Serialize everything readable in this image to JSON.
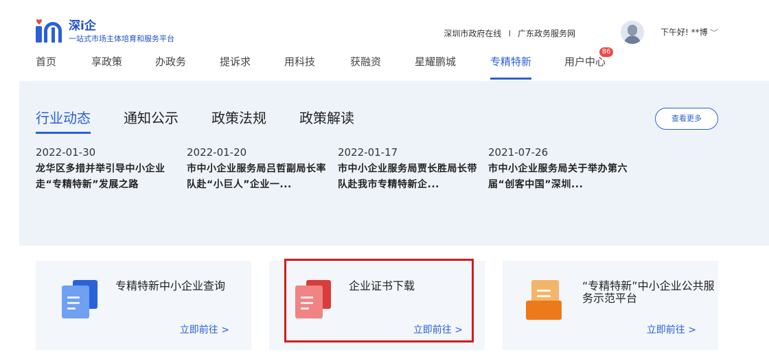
{
  "header": {
    "logo_title": "深i企",
    "logo_subtitle": "一站式市场主体培育和服务平台",
    "links": [
      "深圳市政府在线",
      "广东政务服务网"
    ],
    "link_separator": "I",
    "greeting": "下午好! **博",
    "greeting_chevron": "﹀"
  },
  "nav": {
    "items": [
      "首页",
      "享政策",
      "办政务",
      "提诉求",
      "用科技",
      "获融资",
      "星耀鹏城",
      "专精特新",
      "用户中心"
    ],
    "active": "专精特新",
    "user_badge": "86"
  },
  "news": {
    "tabs": [
      "行业动态",
      "通知公示",
      "政策法规",
      "政策解读"
    ],
    "active_tab": "行业动态",
    "more_label": "查看更多",
    "articles": [
      {
        "date": "2022-01-30",
        "title": "龙华区多措并举引导中小企业走“专精特新”发展之路"
      },
      {
        "date": "2022-01-20",
        "title": "市中小企业服务局吕哲副局长率队赴“小巨人”企业一..."
      },
      {
        "date": "2022-01-17",
        "title": "市中小企业服务局贾长胜局长带队赴我市专精特新企..."
      },
      {
        "date": "2021-07-26",
        "title": "市中小企业服务局关于举办第六届“创客中国”深圳..."
      }
    ]
  },
  "cards": [
    {
      "title": "专精特新中小企业查询",
      "link": "立即前往 >",
      "icon": "blue-document-icon"
    },
    {
      "title": "企业证书下载",
      "link": "立即前往 >",
      "icon": "red-certificate-icon"
    },
    {
      "title": "“专精特新”中小企业公共服务示范平台",
      "link": "立即前往 >",
      "icon": "orange-platform-icon"
    }
  ],
  "colors": {
    "accent": "#2a5fd8",
    "highlight": "#d21c1c",
    "badge": "#f04848"
  }
}
